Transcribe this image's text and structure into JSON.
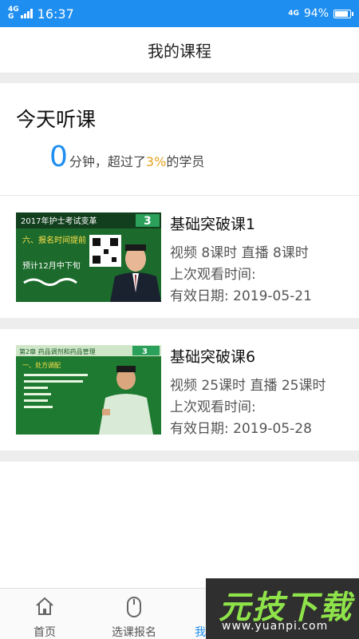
{
  "status_bar": {
    "network_left": "4G",
    "network_left2": "G",
    "time": "16:37",
    "network_right": "4G",
    "battery": "94%",
    "battery_level": 0.94
  },
  "header": {
    "title": "我的课程"
  },
  "today": {
    "title": "今天听课",
    "minutes": "0",
    "minutes_unit": "分钟，超过了",
    "percent": "3%",
    "suffix": "的学员"
  },
  "courses": [
    {
      "title": "基础突破课1",
      "counts": "视频 8课时  直播 8课时",
      "last_watch": "上次观看时间:",
      "valid": "有效日期: 2019-05-21",
      "thumb": {
        "banner": "2017年护士考试变革",
        "line1": "六、报名时间提前",
        "line2": "预计12月中下旬",
        "logo": "3"
      }
    },
    {
      "title": "基础突破课6",
      "counts": "视频 25课时  直播 25课时",
      "last_watch": "上次观看时间:",
      "valid": "有效日期: 2019-05-28",
      "thumb": {
        "banner": "第2章  药品调剂和药品管理",
        "line1": "一、处方调配",
        "line2": "",
        "logo": "3"
      }
    }
  ],
  "nav": {
    "items": [
      {
        "label": "首页",
        "icon": "home-icon"
      },
      {
        "label": "选课报名",
        "icon": "mouse-icon"
      },
      {
        "label": "我的课程",
        "icon": "book-icon",
        "active": true
      }
    ]
  },
  "watermark": {
    "text": "元技下载",
    "url": "www.yuanpi.com"
  },
  "colors": {
    "primary": "#1e8ef0",
    "accent": "#e3a21a",
    "board": "#1c6b2c"
  }
}
